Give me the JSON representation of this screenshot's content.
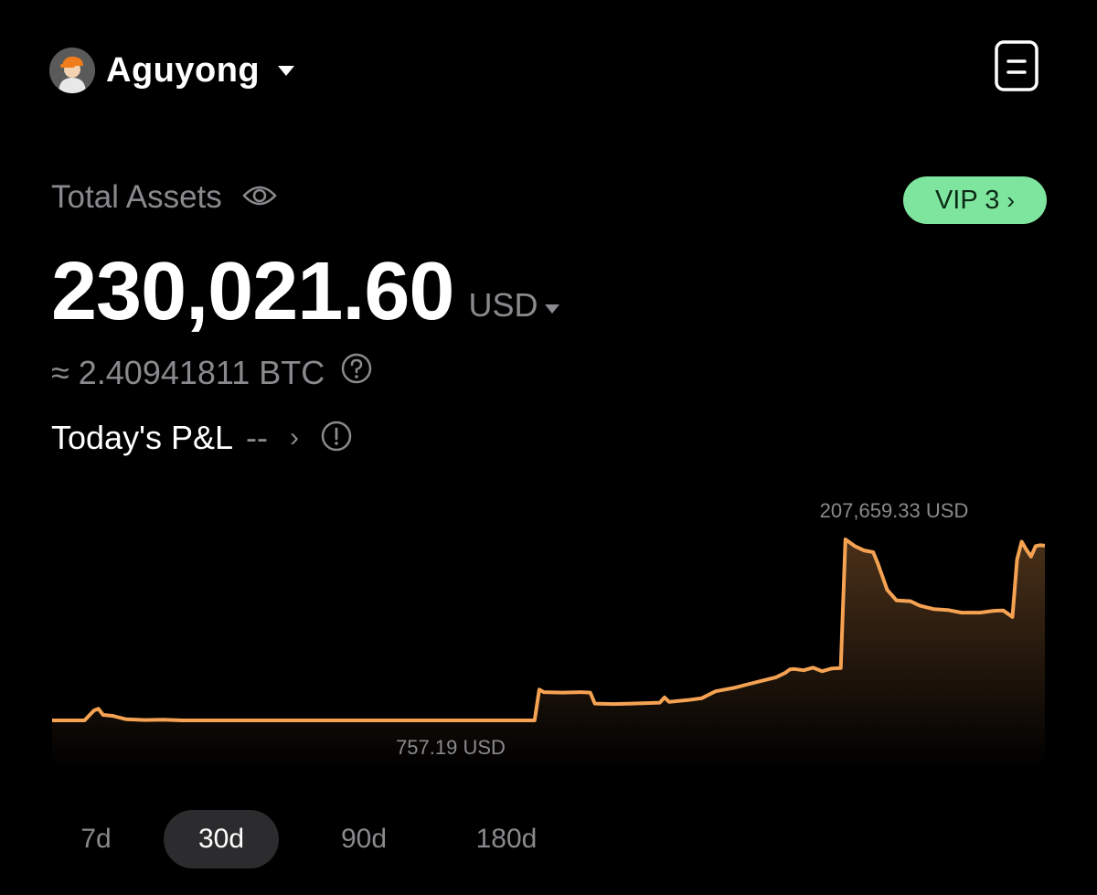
{
  "header": {
    "username": "Aguyong"
  },
  "assets": {
    "label": "Total Assets",
    "amount": "230,021.60",
    "currency": "USD",
    "btc_equivalent": "≈ 2.40941811 BTC",
    "vip_label": "VIP 3",
    "vip_color": "#7ee59e"
  },
  "pnl": {
    "label": "Today's P&L",
    "value": "--"
  },
  "chart_data": {
    "type": "area",
    "max_label": "207,659.33 USD",
    "min_label": "757.19 USD",
    "line_color": "#f5a253",
    "points": [
      [
        0,
        757
      ],
      [
        7,
        757
      ],
      [
        9,
        12000
      ],
      [
        10,
        14000
      ],
      [
        11,
        7000
      ],
      [
        13,
        6000
      ],
      [
        16,
        2000
      ],
      [
        20,
        1200
      ],
      [
        24,
        1500
      ],
      [
        28,
        800
      ],
      [
        32,
        757
      ],
      [
        40,
        757
      ],
      [
        50,
        757
      ],
      [
        60,
        757
      ],
      [
        70,
        757
      ],
      [
        80,
        757
      ],
      [
        90,
        757
      ],
      [
        100,
        757
      ],
      [
        104,
        757
      ],
      [
        105,
        36000
      ],
      [
        106,
        33000
      ],
      [
        110,
        32500
      ],
      [
        114,
        33000
      ],
      [
        116,
        32500
      ],
      [
        117,
        20000
      ],
      [
        121,
        19500
      ],
      [
        125,
        20000
      ],
      [
        128,
        20500
      ],
      [
        131,
        21000
      ],
      [
        132,
        27000
      ],
      [
        133,
        22000
      ],
      [
        137,
        24000
      ],
      [
        140,
        26000
      ],
      [
        143,
        34000
      ],
      [
        147,
        38000
      ],
      [
        150,
        42000
      ],
      [
        153,
        46000
      ],
      [
        156,
        50000
      ],
      [
        158,
        55000
      ],
      [
        159,
        59000
      ],
      [
        160,
        59500
      ],
      [
        162,
        58000
      ],
      [
        164,
        61000
      ],
      [
        166,
        57000
      ],
      [
        168,
        60000
      ],
      [
        170,
        60500
      ],
      [
        171,
        207659
      ],
      [
        173,
        200000
      ],
      [
        175,
        195000
      ],
      [
        177,
        193000
      ],
      [
        178,
        180000
      ],
      [
        180,
        150000
      ],
      [
        182,
        138000
      ],
      [
        185,
        137000
      ],
      [
        187,
        132000
      ],
      [
        190,
        128000
      ],
      [
        193,
        127000
      ],
      [
        196,
        124000
      ],
      [
        200,
        124000
      ],
      [
        203,
        126000
      ],
      [
        205,
        126500
      ],
      [
        207,
        119000
      ],
      [
        208,
        185000
      ],
      [
        209,
        205000
      ],
      [
        210,
        196000
      ],
      [
        211,
        188000
      ],
      [
        212,
        200000
      ],
      [
        213,
        201000
      ],
      [
        214,
        200500
      ]
    ]
  },
  "range_tabs": [
    {
      "label": "7d",
      "active": false
    },
    {
      "label": "30d",
      "active": true
    },
    {
      "label": "90d",
      "active": false
    },
    {
      "label": "180d",
      "active": false
    }
  ]
}
